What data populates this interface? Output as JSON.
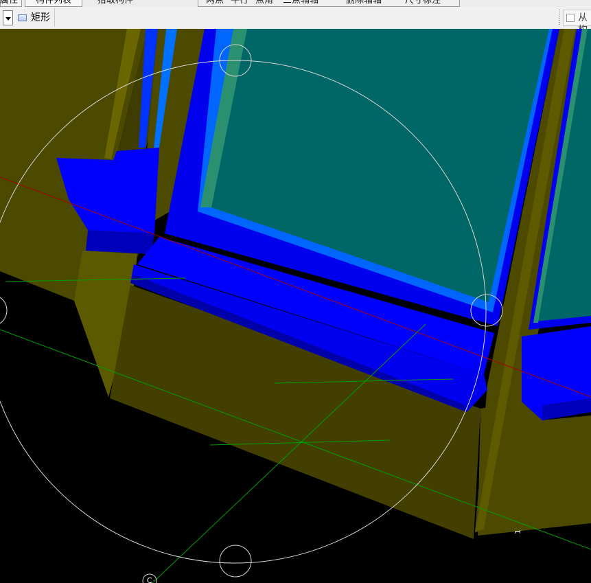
{
  "top_toolbar": {
    "items": [
      "属性",
      "构件列表",
      "拾取构件",
      "两点",
      "平行",
      "点角",
      "三点辅轴",
      "删除辅轴",
      "尺寸标注"
    ]
  },
  "second_toolbar": {
    "shape_label": "矩形",
    "from_button_label": "从构"
  },
  "viewport": {
    "background": "#000000",
    "wall_color": "#4d4a00",
    "frame_color": "#0000ee",
    "glass_color": "#006666",
    "axis_labels": [
      "1",
      "C"
    ]
  }
}
